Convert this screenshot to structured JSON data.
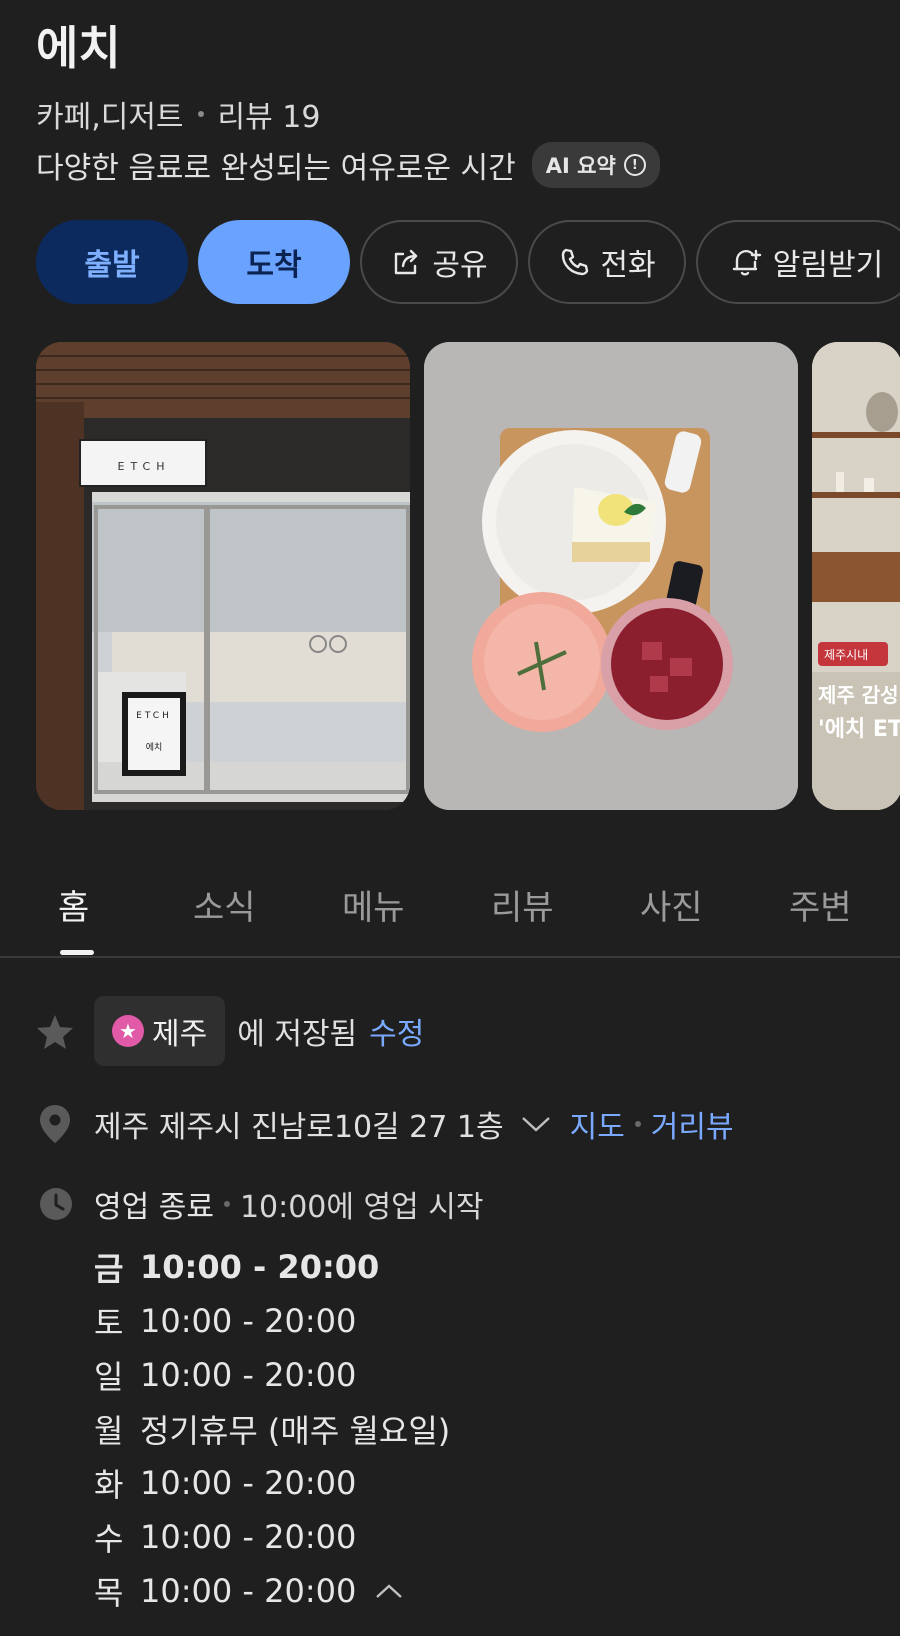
{
  "place": {
    "name": "에치",
    "category": "카페,디저트",
    "review_label": "리뷰 19",
    "description": "다양한 음료로 완성되는 여유로운 시간",
    "ai_badge": "AI 요약",
    "ai_info_icon": "!"
  },
  "actions": {
    "depart": "출발",
    "arrive": "도착",
    "share": "공유",
    "call": "전화",
    "alarm": "알림받기"
  },
  "photos": {
    "sign_top": "ETCH",
    "sign_board_top": "ETCH",
    "sign_board_bottom": "에치",
    "overlay_tag": "제주시내",
    "overlay_line1": "제주 감성",
    "overlay_line2": "'에치 ET"
  },
  "tabs": [
    "홈",
    "소식",
    "메뉴",
    "리뷰",
    "사진",
    "주변"
  ],
  "saved": {
    "list_name": "제주",
    "suffix": "에 저장됨",
    "edit": "수정"
  },
  "address": {
    "text": "제주 제주시 진남로10길 27 1층",
    "map_link": "지도",
    "street_view_link": "거리뷰"
  },
  "status": {
    "state": "영업 종료",
    "next": "10:00에 영업 시작"
  },
  "hours": [
    {
      "day": "금",
      "time": "10:00 - 20:00"
    },
    {
      "day": "토",
      "time": "10:00 - 20:00"
    },
    {
      "day": "일",
      "time": "10:00 - 20:00"
    },
    {
      "day": "월",
      "time": "정기휴무 (매주 월요일)"
    },
    {
      "day": "화",
      "time": "10:00 - 20:00"
    },
    {
      "day": "수",
      "time": "10:00 - 20:00"
    },
    {
      "day": "목",
      "time": "10:00 - 20:00"
    }
  ],
  "colors": {
    "background": "#1f1f1f",
    "accent_blue": "#6aa3ff",
    "depart_bg": "#0d2a5e",
    "link": "#7aaaff",
    "list_pin": "#e05aa8"
  }
}
